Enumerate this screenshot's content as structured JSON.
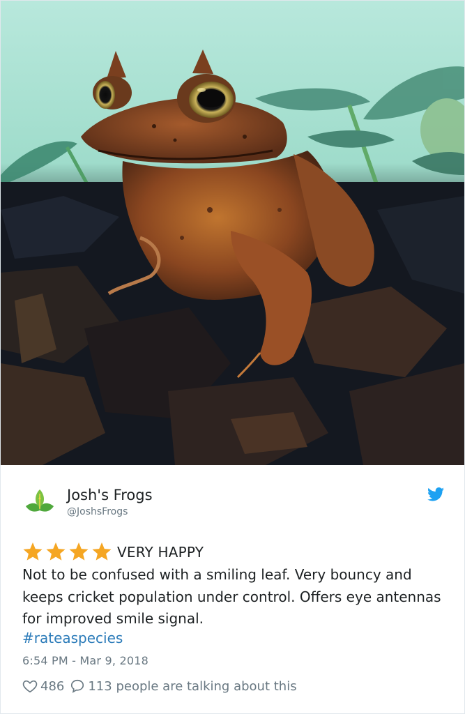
{
  "tweet": {
    "display_name": "Josh's Frogs",
    "handle": "@JoshsFrogs",
    "rating": {
      "stars": 4,
      "label": "VERY HAPPY"
    },
    "body": "Not to be confused with a smiling leaf. Very bouncy and keeps cricket population under control. Offers eye antennas for improved smile signal.",
    "hashtag": "#rateaspecies",
    "timestamp": "6:54 PM - Mar 9, 2018",
    "likes": "486",
    "conversation": "113 people are talking about this"
  },
  "icons": {
    "avatar": "leaf-logo-icon",
    "platform": "bird-icon",
    "star": "star-icon",
    "like": "heart-icon",
    "reply": "speech-bubble-icon"
  },
  "colors": {
    "star": "#f5a623",
    "link": "#2b7bb9",
    "bird": "#1da1f2",
    "muted": "#697882",
    "text": "#1c2022"
  }
}
